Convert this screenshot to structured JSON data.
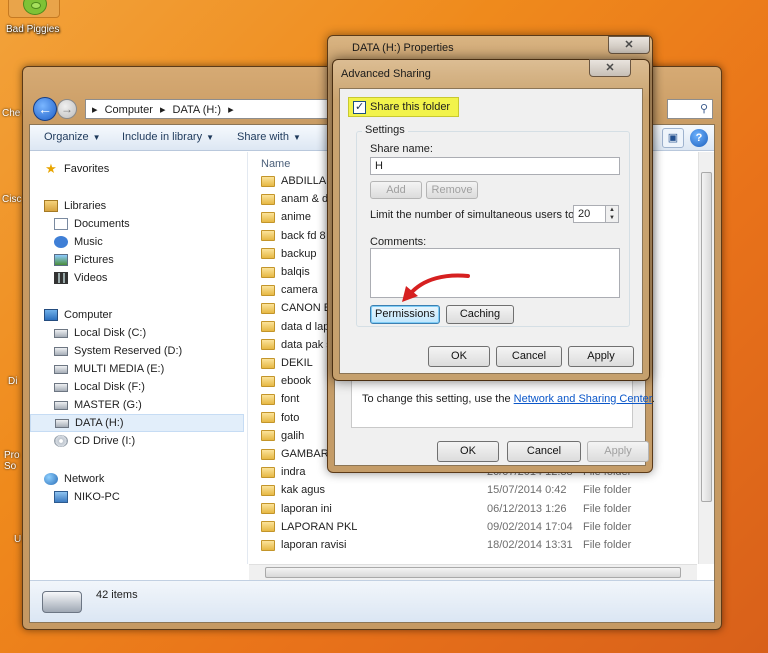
{
  "desktop": {
    "icons": [
      {
        "label": "Bad Piggies"
      },
      {
        "label": "Che"
      },
      {
        "label": "Cisc"
      },
      {
        "label": "Di"
      },
      {
        "label": "Pro So"
      },
      {
        "label": "U"
      }
    ]
  },
  "explorer": {
    "breadcrumb": [
      "Computer",
      "DATA (H:)"
    ],
    "toolbar": {
      "organize": "Organize",
      "include": "Include in library",
      "share": "Share with"
    },
    "column_name": "Name",
    "sidebar": {
      "favorites": "Favorites",
      "libraries": "Libraries",
      "documents": "Documents",
      "music": "Music",
      "pictures": "Pictures",
      "videos": "Videos",
      "computer": "Computer",
      "drives": [
        "Local Disk (C:)",
        "System Reserved (D:)",
        "MULTI MEDIA (E:)",
        "Local Disk (F:)",
        "MASTER (G:)",
        "DATA (H:)",
        "CD Drive (I:)"
      ],
      "network": "Network",
      "niko_pc": "NIKO-PC"
    },
    "files": [
      {
        "name": "ABDILLAH",
        "date": "",
        "type": ""
      },
      {
        "name": "anam & dv",
        "date": "",
        "type": ""
      },
      {
        "name": "anime",
        "date": "",
        "type": ""
      },
      {
        "name": "back fd 8 g",
        "date": "",
        "type": ""
      },
      {
        "name": "backup",
        "date": "",
        "type": ""
      },
      {
        "name": "balqis",
        "date": "",
        "type": ""
      },
      {
        "name": "camera",
        "date": "",
        "type": ""
      },
      {
        "name": "CANON EO",
        "date": "",
        "type": ""
      },
      {
        "name": "data d lapt",
        "date": "",
        "type": ""
      },
      {
        "name": "data pak si",
        "date": "",
        "type": ""
      },
      {
        "name": "DEKIL",
        "date": "",
        "type": ""
      },
      {
        "name": "ebook",
        "date": "",
        "type": ""
      },
      {
        "name": "font",
        "date": "",
        "type": ""
      },
      {
        "name": "foto",
        "date": "",
        "type": ""
      },
      {
        "name": "galih",
        "date": "",
        "type": ""
      },
      {
        "name": "GAMBAR_",
        "date": "",
        "type": ""
      },
      {
        "name": "indra",
        "date": "20/07/2014 12:38",
        "type": "File folder"
      },
      {
        "name": "kak agus",
        "date": "15/07/2014 0:42",
        "type": "File folder"
      },
      {
        "name": "laporan ini",
        "date": "06/12/2013 1:26",
        "type": "File folder"
      },
      {
        "name": "LAPORAN PKL",
        "date": "09/02/2014 17:04",
        "type": "File folder"
      },
      {
        "name": "laporan ravisi",
        "date": "18/02/2014 13:31",
        "type": "File folder"
      }
    ],
    "status": "42 items"
  },
  "properties": {
    "title": "DATA (H:) Properties",
    "info_text": "To change this setting, use the ",
    "info_link": "Network and Sharing Center",
    "info_end": ".",
    "ok": "OK",
    "cancel": "Cancel",
    "apply": "Apply"
  },
  "advanced": {
    "title": "Advanced Sharing",
    "share_checkbox": "Share this folder",
    "settings": "Settings",
    "share_name_label": "Share name:",
    "share_name_value": "H",
    "add": "Add",
    "remove": "Remove",
    "limit_label": "Limit the number of simultaneous users to:",
    "limit_value": "20",
    "comments_label": "Comments:",
    "permissions": "Permissions",
    "caching": "Caching",
    "ok": "OK",
    "cancel": "Cancel",
    "apply": "Apply"
  },
  "colors": {
    "highlight": "#f2f34b",
    "arrow": "#d62020",
    "link": "#0b57c9"
  }
}
